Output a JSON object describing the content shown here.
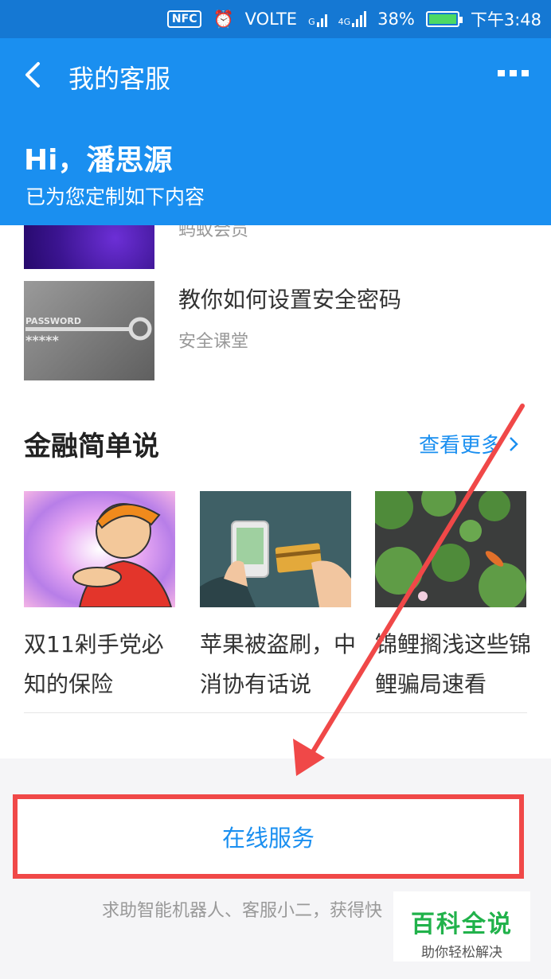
{
  "status_bar": {
    "nfc": "NFC",
    "network": "VOLTE",
    "sim1": "G",
    "sim2": "4G",
    "battery": "38%",
    "time": "下午3:48"
  },
  "header": {
    "title": "我的客服",
    "greeting": "Hi，潘思源",
    "subtitle": "已为您定制如下内容"
  },
  "articles": [
    {
      "tag": "蚂蚁会员"
    },
    {
      "title": "教你如何设置安全密码",
      "tag": "安全课堂",
      "image_text": "PASSWORD",
      "image_mask": "*****"
    }
  ],
  "section": {
    "title": "金融简单说",
    "see_more": "查看更多"
  },
  "cards": [
    {
      "title": "双11剁手党必知的保险"
    },
    {
      "title": "苹果被盗刷，中消协有话说"
    },
    {
      "title": "锦鲤搁浅这些锦鲤骗局速看"
    }
  ],
  "service": {
    "button_label": "在线服务",
    "hint": "求助智能机器人、客服小二，获得快"
  },
  "watermark": {
    "title": "百科全说",
    "subtitle": "助你轻松解决"
  },
  "colors": {
    "brand_blue": "#1a8ff0",
    "annotation_red": "#f04848",
    "watermark_green": "#21b24b"
  }
}
